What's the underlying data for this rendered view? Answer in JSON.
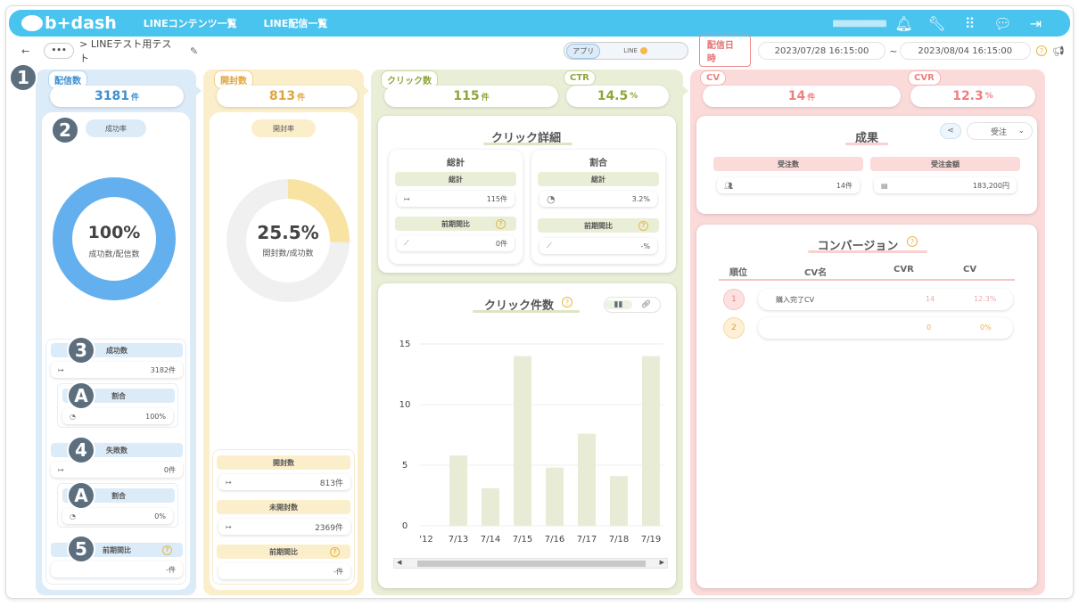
{
  "app": {
    "logo": "b+dash",
    "nav": [
      "LINEコンテンツ一覧",
      "LINE配信一覧"
    ],
    "user": "■■■■■■■■"
  },
  "icons": [
    "bell-icon",
    "wrench-icon",
    "grid-icon",
    "chat-icon",
    "logout-icon"
  ],
  "subbar": {
    "back": "←",
    "more": "•••",
    "breadcrumb": "> LINEテスト用テスト",
    "toggle_app": "アプリ",
    "toggle_line": "LINE",
    "date_label": "配信日時",
    "date_from": "2023/07/28 16:15:00",
    "tilde": "~",
    "date_to": "2023/08/04 16:15:00"
  },
  "markers": [
    "1",
    "2",
    "3",
    "A",
    "4",
    "A",
    "5"
  ],
  "delivery": {
    "tag": "配信数",
    "value": "3181",
    "unit": "件",
    "rate_label": "成功率",
    "donut_pct": "100%",
    "donut_sub": "成功数/配信数",
    "donut_fraction": 1.0,
    "success_label": "成功数",
    "success_value": "3182件",
    "ratio_label": "割合",
    "success_ratio": "100%",
    "fail_label": "失敗数",
    "fail_value": "0件",
    "fail_ratio_label": "割合",
    "fail_ratio": "0%",
    "prev_label": "前期間比",
    "prev_value": "-件"
  },
  "open": {
    "tag": "開封数",
    "value": "813",
    "unit": "件",
    "rate_label": "開封率",
    "donut_pct": "25.5%",
    "donut_sub": "開封数/成功数",
    "donut_fraction": 0.255,
    "opened_label": "開封数",
    "opened_value": "813",
    "unopened_label": "未開封数",
    "unopened_value": "2369",
    "unit_small": "件",
    "prev_label": "前期間比",
    "prev_value": "-件"
  },
  "click": {
    "tag": "クリック数",
    "value": "115",
    "unit": "件",
    "ctr_tag": "CTR",
    "ctr_value": "14.5",
    "ctr_unit": "%",
    "detail_title": "クリック詳細",
    "total_header": "総計",
    "total_sub": "総計",
    "total_value": "115件",
    "total_prev_label": "前期間比",
    "total_prev_value": "0件",
    "ratio_header": "割合",
    "ratio_sub": "総計",
    "ratio_value": "3.2%",
    "ratio_prev_label": "前期間比",
    "ratio_prev_value": "-%",
    "chart_title": "クリック件数"
  },
  "chart_data": {
    "type": "bar",
    "categories": [
      "7/12",
      "7/13",
      "7/14",
      "7/15",
      "7/16",
      "7/17",
      "7/18",
      "7/19"
    ],
    "visible_tick_labels": [
      "'12",
      "7/13",
      "7/14",
      "7/15",
      "7/16",
      "7/17",
      "7/18",
      "7/19"
    ],
    "values": [
      0,
      5.8,
      3.1,
      14,
      4.8,
      7.6,
      4.1,
      14
    ],
    "yticks": [
      "15",
      "10",
      "5",
      "0"
    ],
    "ylim": [
      0,
      15
    ],
    "grid": true,
    "bar_color": "#e8ecd6"
  },
  "cv": {
    "tag": "CV",
    "value": "14",
    "unit": "件",
    "cvr_tag": "CVR",
    "cvr_value": "12.3",
    "cvr_unit": "%",
    "result_title": "成果",
    "order_select": "受注",
    "orders_label": "受注数",
    "orders_value": "14件",
    "amount_label": "受注金額",
    "amount_value": "183,200円",
    "conv_title": "コンバージョン",
    "table_headers": [
      "順位",
      "CV名",
      "CVR",
      "CV"
    ],
    "rows": [
      {
        "rank": "1",
        "name": "購入完了CV",
        "cvr": "14",
        "cv": "12.3%"
      },
      {
        "rank": "2",
        "name": "",
        "cvr": "0",
        "cv": "0%"
      }
    ]
  },
  "colors": {
    "blue": "#64b0ee",
    "yellow": "#f9e3a3",
    "green": "#dde6c4",
    "pink": "#f8d0d0",
    "topbar": "#48c4ee"
  }
}
